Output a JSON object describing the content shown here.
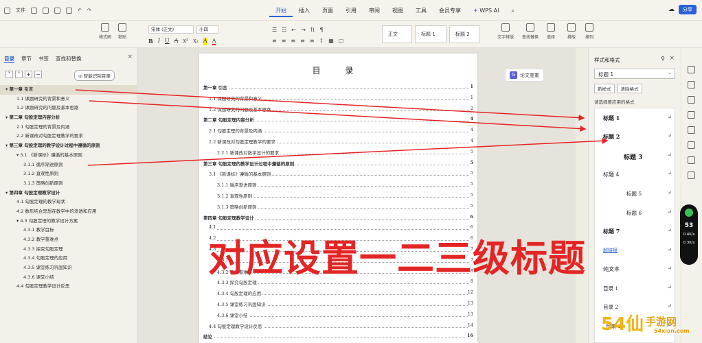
{
  "titlebar": {
    "file_label": "文件",
    "menus": [
      "开始",
      "插入",
      "页面",
      "引用",
      "审阅",
      "视图",
      "工具",
      "会员专享"
    ],
    "ai_label": "WPS AI",
    "share_label": "分享"
  },
  "ribbon": {
    "format_painter": "格式刷",
    "paste": "粘贴",
    "font_name": "宋体 (正文)",
    "font_size": "小四",
    "style_normal": "正文",
    "style_h1": "标题 1",
    "style_h2": "标题 2",
    "text_tools": "文字排版",
    "find_replace": "查找替换",
    "select": "选择",
    "arrange": "排版",
    "order": "排列"
  },
  "left_panel": {
    "tabs": [
      "目录",
      "章节",
      "书签",
      "查找和替换"
    ],
    "smart_toc": "智能识别目录",
    "items": [
      {
        "level": 1,
        "text": "▾ 第一章  引言"
      },
      {
        "level": 2,
        "text": "1.1  课题研究的背景和意义"
      },
      {
        "level": 2,
        "text": "1.2 课题研究的问题及基本思路"
      },
      {
        "level": 1,
        "text": "▾ 第二章  勾股定理内容分析"
      },
      {
        "level": 2,
        "text": "2.1  勾股定理的背景及内涵"
      },
      {
        "level": 2,
        "text": "2.2  新课改对勾股定理教学的要求"
      },
      {
        "level": 1,
        "text": "▾ 第三章  勾股定理的教学设计过程中遵循的原则"
      },
      {
        "level": 2,
        "text": "▾ 3.1  《新课标》遵循的基本原则"
      },
      {
        "level": 3,
        "text": "3.1.1  循序渐进原则"
      },
      {
        "level": 3,
        "text": "3.1.2  直观性原则"
      },
      {
        "level": 3,
        "text": "3.1.3  策略创新原则"
      },
      {
        "level": 1,
        "text": "▾ 第四章  勾股定理教学设计"
      },
      {
        "level": 2,
        "text": "4.1  勾股定理的教学现状"
      },
      {
        "level": 2,
        "text": "4.2  数形结合思想在教学中的渗透和应用"
      },
      {
        "level": 2,
        "text": "▾ 4.3 勾股定理的教学设计方案"
      },
      {
        "level": 3,
        "text": "4.3.1  教学目标"
      },
      {
        "level": 3,
        "text": "4.3.2  教学重难点"
      },
      {
        "level": 3,
        "text": "4.3.3  探究勾股定理"
      },
      {
        "level": 3,
        "text": "4.3.4    勾股定理的应用"
      },
      {
        "level": 3,
        "text": "4.3.5  课堂练习巩固知识"
      },
      {
        "level": 3,
        "text": "4.3.6  课堂小结"
      },
      {
        "level": 2,
        "text": "4.4  勾股定理教学设计反思"
      }
    ]
  },
  "document": {
    "toc_title": "目 录",
    "entries": [
      {
        "level": 1,
        "text": "第一章  引言",
        "page": "1"
      },
      {
        "level": 2,
        "text": "1.1  课题研究的背景和意义",
        "page": "1"
      },
      {
        "level": 2,
        "text": "1.2  课题研究的问题及基本思路",
        "page": "2"
      },
      {
        "level": 1,
        "text": "第二章  勾股定理内容分析",
        "page": "4"
      },
      {
        "level": 2,
        "text": "2.1  勾股定理的背景及内涵",
        "page": "4"
      },
      {
        "level": 2,
        "text": "2.2  新课改对勾股定理教学的要求",
        "page": "4"
      },
      {
        "level": 3,
        "text": "2.2.1  新课改对数学设计的要求",
        "page": "5"
      },
      {
        "level": 1,
        "text": "第三章  勾股定理的教学设计过程中遵循的原则",
        "page": "5"
      },
      {
        "level": 2,
        "text": "3.1 《新课标》遵循的基本原则",
        "page": "5"
      },
      {
        "level": 3,
        "text": "3.1.1  循序渐进原则",
        "page": "5"
      },
      {
        "level": 3,
        "text": "3.1.2  直观性原则",
        "page": "5"
      },
      {
        "level": 3,
        "text": "3.1.3  策略创新原则",
        "page": "5"
      },
      {
        "level": 1,
        "text": "第四章  勾股定理教学设计",
        "page": "6"
      },
      {
        "level": 2,
        "text": "4.1",
        "page": "6"
      },
      {
        "level": 2,
        "text": "4.2",
        "page": "6"
      },
      {
        "level": 2,
        "text": "4.3",
        "page": "7"
      },
      {
        "level": 3,
        "text": "4.3.1",
        "page": "7"
      },
      {
        "level": 3,
        "text": "4.3.2  教学重难点",
        "page": "8"
      },
      {
        "level": 3,
        "text": "4.3.3  探究勾股定理",
        "page": "8"
      },
      {
        "level": 3,
        "text": "4.3.4    勾股定理的应用",
        "page": "12"
      },
      {
        "level": 3,
        "text": "4.3.5  课堂练习巩固知识",
        "page": "13"
      },
      {
        "level": 3,
        "text": "4.3.6  课堂小结",
        "page": "13"
      },
      {
        "level": 2,
        "text": "4.4 勾股定理教学设计反思",
        "page": "14"
      },
      {
        "level": 1,
        "text": "结论",
        "page": "16"
      }
    ],
    "essay_check": "论文查重",
    "essay_badge": "G"
  },
  "right_panel": {
    "title": "样式和格式",
    "current_style": "标题 1",
    "new_style": "新样式",
    "clear_format": "清除格式",
    "hint": "请选择要应用的格式",
    "styles": [
      "标题 1",
      "标题 2",
      "标题 3",
      "标题 4",
      "标题 5",
      "标题 6",
      "标题 7",
      "超链接",
      "纯文本",
      "目录 1",
      "目录 2",
      "目录 3"
    ]
  },
  "zoom": {
    "value": "53",
    "line1": "0.4K/s",
    "line2": "0.3K/s"
  },
  "overlay": {
    "caption": "对应设置一二三级标题"
  },
  "watermark": {
    "brand": "54仙",
    "site": "手游网",
    "url": "54xian.com"
  },
  "colors": {
    "accent": "#2a62d6",
    "annotation": "#e42525"
  }
}
